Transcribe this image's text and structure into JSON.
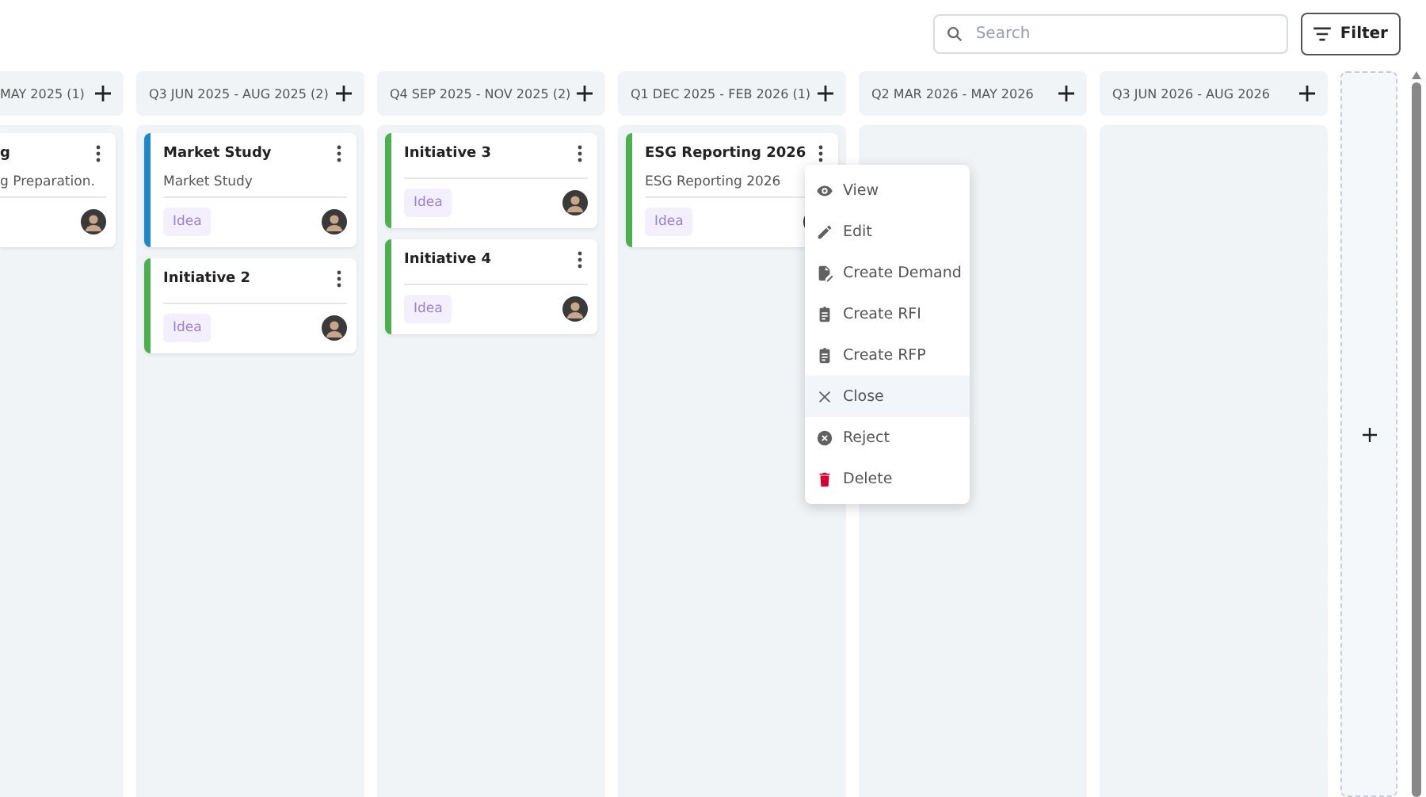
{
  "toolbar": {
    "search": {
      "placeholder": "Search"
    },
    "filter_button": "Filter"
  },
  "columns": [
    {
      "title": "MAY 2025 (1)",
      "cut": true,
      "cards": [
        {
          "title": "g",
          "description": "g Preparation."
        }
      ]
    },
    {
      "title": "Q3 JUN 2025 - AUG 2025 (2)",
      "cut": false,
      "cards": [
        {
          "title": "Market Study",
          "description": "Market Study",
          "tag": "Idea",
          "color": "#1e88c9"
        },
        {
          "title": "Initiative 2",
          "tag": "Idea",
          "color": "#4caf50"
        }
      ]
    },
    {
      "title": "Q4 SEP 2025 - NOV 2025 (2)",
      "cut": false,
      "cards": [
        {
          "title": "Initiative 3",
          "tag": "Idea",
          "color": "#4caf50"
        },
        {
          "title": "Initiative 4",
          "tag": "Idea",
          "color": "#4caf50"
        }
      ]
    },
    {
      "title": "Q1 DEC 2025 - FEB 2026 (1)",
      "cut": false,
      "cards": [
        {
          "title": "ESG Reporting 2026",
          "description": "ESG Reporting 2026",
          "tag": "Idea",
          "color": "#4caf50",
          "menu_open": true
        }
      ]
    },
    {
      "title": "Q2 MAR 2026 - MAY 2026",
      "cut": false
    },
    {
      "title": "Q3 JUN 2026 - AUG 2026",
      "cut": false
    }
  ],
  "context_menu": [
    {
      "label": "View",
      "kind": "eye",
      "hovered": false
    },
    {
      "label": "Edit",
      "kind": "pencil",
      "hovered": false
    },
    {
      "label": "Create Demand",
      "kind": "doc",
      "hovered": false
    },
    {
      "label": "Create RFI",
      "kind": "clipboard",
      "hovered": false
    },
    {
      "label": "Create RFP",
      "kind": "clipboard",
      "hovered": false
    },
    {
      "label": "Close",
      "kind": "x",
      "hovered": true
    },
    {
      "label": "Reject",
      "kind": "xcircle",
      "hovered": false
    },
    {
      "label": "Delete",
      "kind": "trash",
      "hovered": false
    }
  ]
}
